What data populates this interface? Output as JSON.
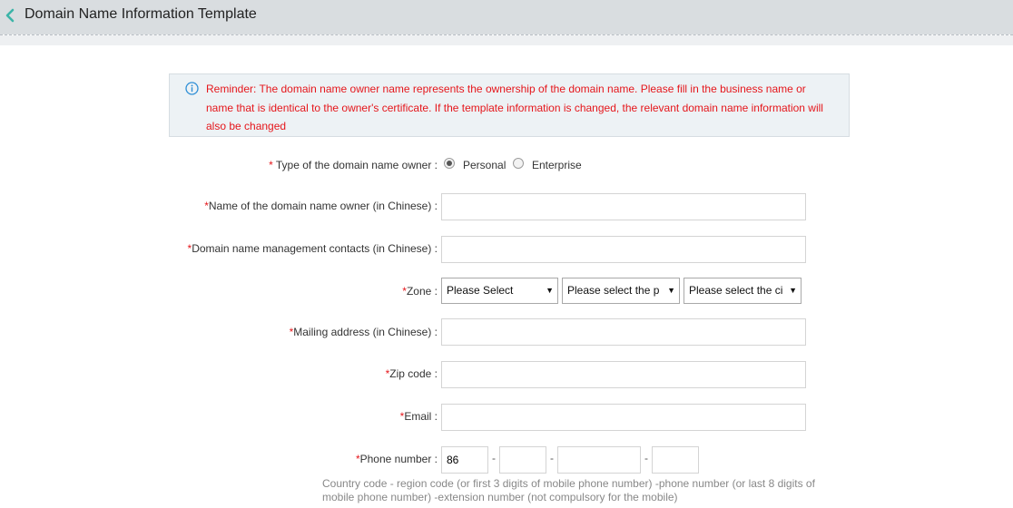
{
  "header": {
    "title": "Domain Name Information Template",
    "back_icon": "chevron-left-icon",
    "accent": "#3cb4a8"
  },
  "reminder": {
    "icon": "info-icon",
    "text": "Reminder: The domain name owner name represents the ownership of the domain name. Please fill in the business name or name that is identical to the owner's certificate. If the template information is changed, the relevant domain name information will also be changed",
    "color": "#e5161b"
  },
  "form": {
    "owner_type": {
      "required": "* ",
      "label": "Type of the domain name owner :",
      "options": [
        "Personal",
        "Enterprise"
      ],
      "selected": "Personal"
    },
    "owner_name": {
      "required": "*",
      "label": "Name of the domain name owner (in Chinese) :",
      "value": ""
    },
    "contacts": {
      "required": "*",
      "label": "Domain name management contacts (in Chinese) :",
      "value": ""
    },
    "zone": {
      "required": "*",
      "label": "Zone :",
      "selects": [
        "Please Select",
        "Please select the p",
        "Please select the ci"
      ]
    },
    "mailing_address": {
      "required": "*",
      "label": "Mailing address (in Chinese) :",
      "value": ""
    },
    "zip_code": {
      "required": "*",
      "label": "Zip code :",
      "value": ""
    },
    "email": {
      "required": "*",
      "label": "Email :",
      "value": ""
    },
    "phone": {
      "required": "*",
      "label": "Phone number :",
      "country_code": "86",
      "region_code": "",
      "number": "",
      "extension": "",
      "separator": "-",
      "hint": "Country code - region code (or first 3 digits of mobile phone number) -phone number (or last 8 digits of mobile phone number) -extension number (not compulsory for the mobile)"
    }
  }
}
